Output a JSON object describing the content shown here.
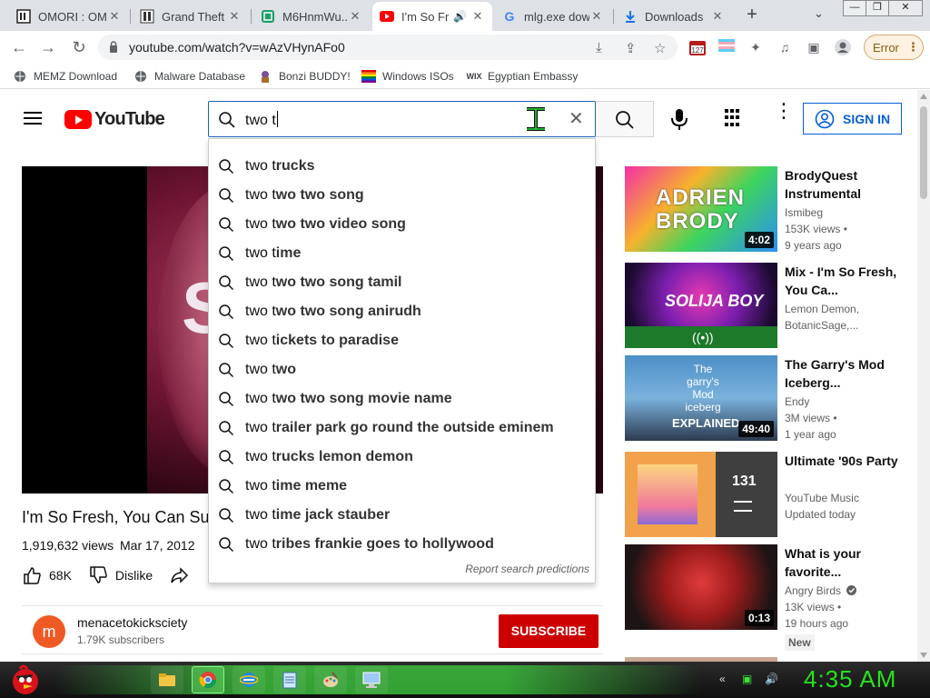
{
  "browser": {
    "tabs": [
      {
        "title": "OMORI : OM",
        "favicon": "omori-icon"
      },
      {
        "title": "Grand Theft",
        "favicon": "gta-icon"
      },
      {
        "title": "M6HnmWu...",
        "favicon": "m6-icon"
      },
      {
        "title": "I'm So Fr",
        "favicon": "youtube-icon"
      },
      {
        "title": "mlg.exe dow",
        "favicon": "google-icon"
      },
      {
        "title": "Downloads",
        "favicon": "download-icon"
      }
    ],
    "url": "youtube.com/watch?v=wAzVHynAFo0",
    "extension_badge": "127",
    "error_label": "Error",
    "bookmarks": [
      {
        "label": "MEMZ Download",
        "icon": "globe-icon"
      },
      {
        "label": "Malware Database",
        "icon": "globe-icon"
      },
      {
        "label": "Bonzi BUDDY!",
        "icon": "bonzi-icon"
      },
      {
        "label": "Windows ISOs",
        "icon": "windows-flag-icon"
      },
      {
        "label": "Egyptian Embassy",
        "icon": "wix-icon"
      }
    ]
  },
  "youtube": {
    "logo_text": "YouTube",
    "search_query": "two t",
    "sign_in": "SIGN IN",
    "suggestions": [
      {
        "base": "two t",
        "rest": "rucks"
      },
      {
        "base": "two t",
        "rest": "wo two song"
      },
      {
        "base": "two t",
        "rest": "wo two video song"
      },
      {
        "base": "two t",
        "rest": "ime"
      },
      {
        "base": "two t",
        "rest": "wo two song tamil"
      },
      {
        "base": "two t",
        "rest": "wo two song anirudh"
      },
      {
        "base": "two t",
        "rest": "ickets to paradise"
      },
      {
        "base": "two t",
        "rest": "wo"
      },
      {
        "base": "two t",
        "rest": "wo two song movie name"
      },
      {
        "base": "two t",
        "rest": "railer park go round the outside eminem"
      },
      {
        "base": "two t",
        "rest": "rucks lemon demon"
      },
      {
        "base": "two t",
        "rest": "ime meme"
      },
      {
        "base": "two t",
        "rest": "ime jack stauber"
      },
      {
        "base": "two t",
        "rest": "ribes frankie goes to hollywood"
      }
    ],
    "report_text": "Report search predictions",
    "video": {
      "title": "I'm So Fresh, You Can Su",
      "views": "1,919,632 views",
      "date": "Mar 17, 2012",
      "likes": "68K",
      "dislike": "Dislike",
      "channel": "menacetokicksciety",
      "channel_initial": "m",
      "subscribers": "1.79K subscribers",
      "subscribe": "SUBSCRIBE"
    },
    "related": [
      {
        "title": "BrodyQuest Instrumental",
        "channel": "Ismibeg",
        "views": "153K views •",
        "age": "9 years ago",
        "duration": "4:02",
        "thumb_text": "ADRIEN BRODY"
      },
      {
        "title": "Mix - I'm So Fresh, You Ca...",
        "channel": "Lemon Demon,",
        "views": "BotanicSage,...",
        "age": "",
        "duration": "",
        "thumb_text": "SOLIJA BOY"
      },
      {
        "title": "The Garry's Mod Iceberg...",
        "channel": "Endy",
        "views": "3M views •",
        "age": "1 year ago",
        "duration": "49:40",
        "thumb_text": "The garry's Mod iceberg",
        "thumb_caption": "EXPLAINED"
      },
      {
        "title": "Ultimate '90s Party",
        "channel": "YouTube Music",
        "views": "Updated today",
        "age": "",
        "duration": "",
        "count": "131"
      },
      {
        "title": "What is your favorite...",
        "channel": "Angry Birds",
        "views": "13K views •",
        "age": "19 hours ago",
        "duration": "0:13",
        "badge": "New"
      }
    ]
  },
  "taskbar": {
    "clock": "4:35 AM"
  },
  "colors": {
    "yt_red": "#ff0000",
    "subscribe_red": "#cc0000",
    "signin_blue": "#065fd4",
    "clock_green": "#27e11f"
  }
}
